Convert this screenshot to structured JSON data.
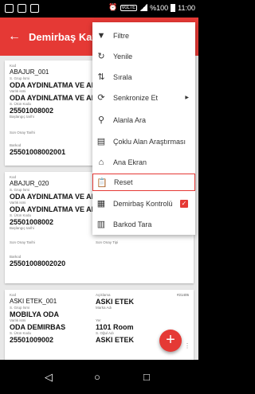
{
  "status": {
    "time": "11:00",
    "battery": "%100",
    "volte": "VoLTE"
  },
  "appbar": {
    "title": "Demirbaş Kayıt"
  },
  "cards": [
    {
      "kod_label": "Kod",
      "kod": "ABAJUR_001",
      "grup_label": "S. Grup İsmi",
      "grup": "ODA AYDINLATMA VE APLIK...",
      "varlik_label": "Varlık ismi",
      "varlik": "ODA AYDINLATMA VE APLIK...",
      "urun_label": "S. Ürün Kodu",
      "urun": "25501008002",
      "baslangic_label": "Başlangıç tarihi",
      "sayim_label": "Son Onay Tarihi",
      "barkod_label": "Barkod",
      "barkod": "25501008002001"
    },
    {
      "kod_label": "Kod",
      "kod": "ABAJUR_020",
      "grup_label": "S. Grup İsmi",
      "grup": "ODA AYDINLATMA VE APLIK...",
      "varlik_label": "Varlık ismi",
      "varlik": "ODA AYDINLATMA VE APLIK...",
      "urun_label": "S. Ürün Kodu",
      "urun": "25501008002",
      "baslangic_label": "Başlangıç tarihi",
      "sayim_label": "Son Onay Tarihi",
      "sayim_tipi_label": "Son Onay Tipi",
      "barkod_label": "Barkod",
      "barkod": "25501008002020"
    },
    {
      "tag": "#21405",
      "kod_label": "Kod",
      "kod": "ASKI ETEK_001",
      "aciklama_label": "Açıklama",
      "aciklama": "ASKI ETEK",
      "grup_label": "S. Grup İsmi",
      "grup": "MOBILYA ODA",
      "marka_label": "Marka Adı",
      "varlik_label": "Varlık ismi",
      "varlik": "ODA DEMIRBAS",
      "yer_label": "Yer",
      "yer": "1101 Room",
      "urun_label": "S. Ürün Kodu",
      "urun": "25501009002",
      "oda_label": "S. Oğul Adı",
      "oda": "ASKI ETEK"
    }
  ],
  "menu": {
    "items": [
      {
        "icon": "filter-icon",
        "label": "Filtre"
      },
      {
        "icon": "refresh-icon",
        "label": "Yenile"
      },
      {
        "icon": "sort-icon",
        "label": "Sırala"
      },
      {
        "icon": "sync-icon",
        "label": "Senkronize Et"
      },
      {
        "icon": "search-icon",
        "label": "Alanla Ara"
      },
      {
        "icon": "multi-search-icon",
        "label": "Çoklu Alan Araştırması"
      },
      {
        "icon": "home-icon",
        "label": "Ana Ekran"
      },
      {
        "icon": "clipboard-icon",
        "label": "Reset"
      },
      {
        "icon": "inventory-check-icon",
        "label": "Demirbaş Kontrolü"
      },
      {
        "icon": "barcode-icon",
        "label": "Barkod Tara"
      }
    ]
  },
  "colors": {
    "accent": "#e53935",
    "background": "#e8e8e8"
  },
  "fab": {
    "label": "+"
  }
}
